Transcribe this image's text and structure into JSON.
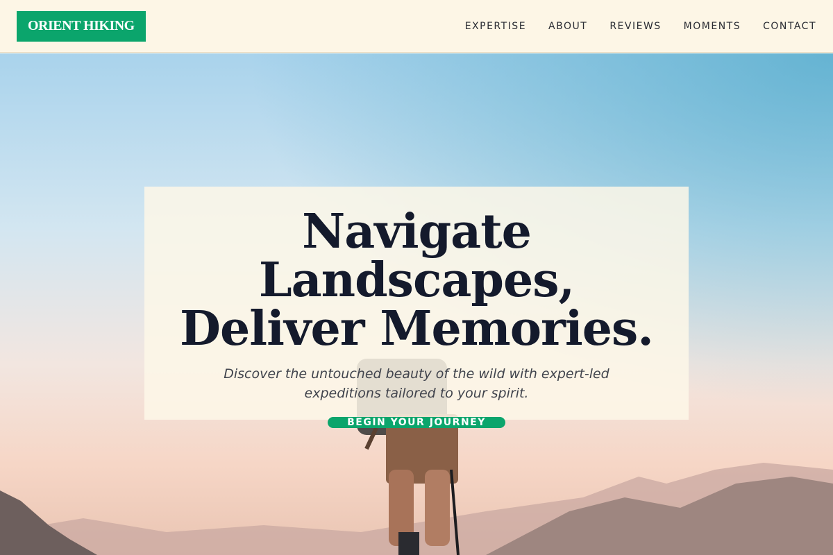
{
  "header": {
    "logo": "ORIENT HIKING",
    "nav": [
      "EXPERTISE",
      "ABOUT",
      "REVIEWS",
      "MOMENTS",
      "CONTACT"
    ]
  },
  "hero": {
    "headline_line1": "Navigate Landscapes,",
    "headline_line2": "Deliver Memories.",
    "subtitle_line1": "Discover the untouched beauty of the wild with expert-led",
    "subtitle_line2": "expeditions tailored to your spirit.",
    "cta_label": "BEGIN YOUR JOURNEY"
  },
  "colors": {
    "accent": "#0ba56c",
    "header_bg": "#fdf6e6",
    "headline": "#141a2c"
  }
}
